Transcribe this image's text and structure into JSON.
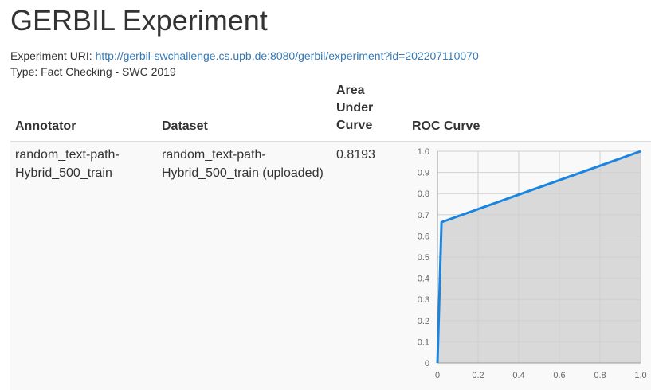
{
  "page": {
    "title": "GERBIL Experiment",
    "uri_label": "Experiment URI:",
    "uri_link": "http://gerbil-swchallenge.cs.upb.de:8080/gerbil/experiment?id=202207110070",
    "type_text": "Type: Fact Checking - SWC 2019"
  },
  "table": {
    "headers": {
      "annotator": "Annotator",
      "dataset": "Dataset",
      "auc": "Area Under Curve",
      "roc": "ROC Curve"
    },
    "rows": [
      {
        "annotator": "random_text-path-Hybrid_500_train",
        "dataset": "random_text-path-Hybrid_500_train (uploaded)",
        "auc": "0.8193"
      }
    ]
  },
  "colors": {
    "curve": "#1a85e0",
    "area_fill": "#d9d9d9",
    "grid": "#d0d0d0",
    "link": "#337ab7"
  },
  "chart_data": {
    "type": "area",
    "x": [
      0,
      0.02,
      1
    ],
    "y": [
      0,
      0.665,
      1
    ],
    "xlim": [
      0,
      1
    ],
    "ylim": [
      0,
      1
    ],
    "x_ticks": [
      "0",
      "0.2",
      "0.4",
      "0.6",
      "0.8",
      "1.0"
    ],
    "y_ticks": [
      "0",
      "0.1",
      "0.2",
      "0.3",
      "0.4",
      "0.5",
      "0.6",
      "0.7",
      "0.8",
      "0.9",
      "1.0"
    ],
    "grid": true
  }
}
